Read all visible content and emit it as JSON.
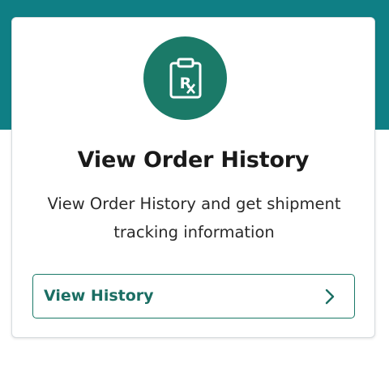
{
  "card": {
    "title": "View Order History",
    "description": "View Order History and get shipment tracking information",
    "icon": "prescription-clipboard-icon",
    "button_label": "View History",
    "button_icon": "chevron-right-icon"
  },
  "colors": {
    "header_band": "#0f7f85",
    "accent": "#1b7a68",
    "button_text": "#1b6e63"
  }
}
